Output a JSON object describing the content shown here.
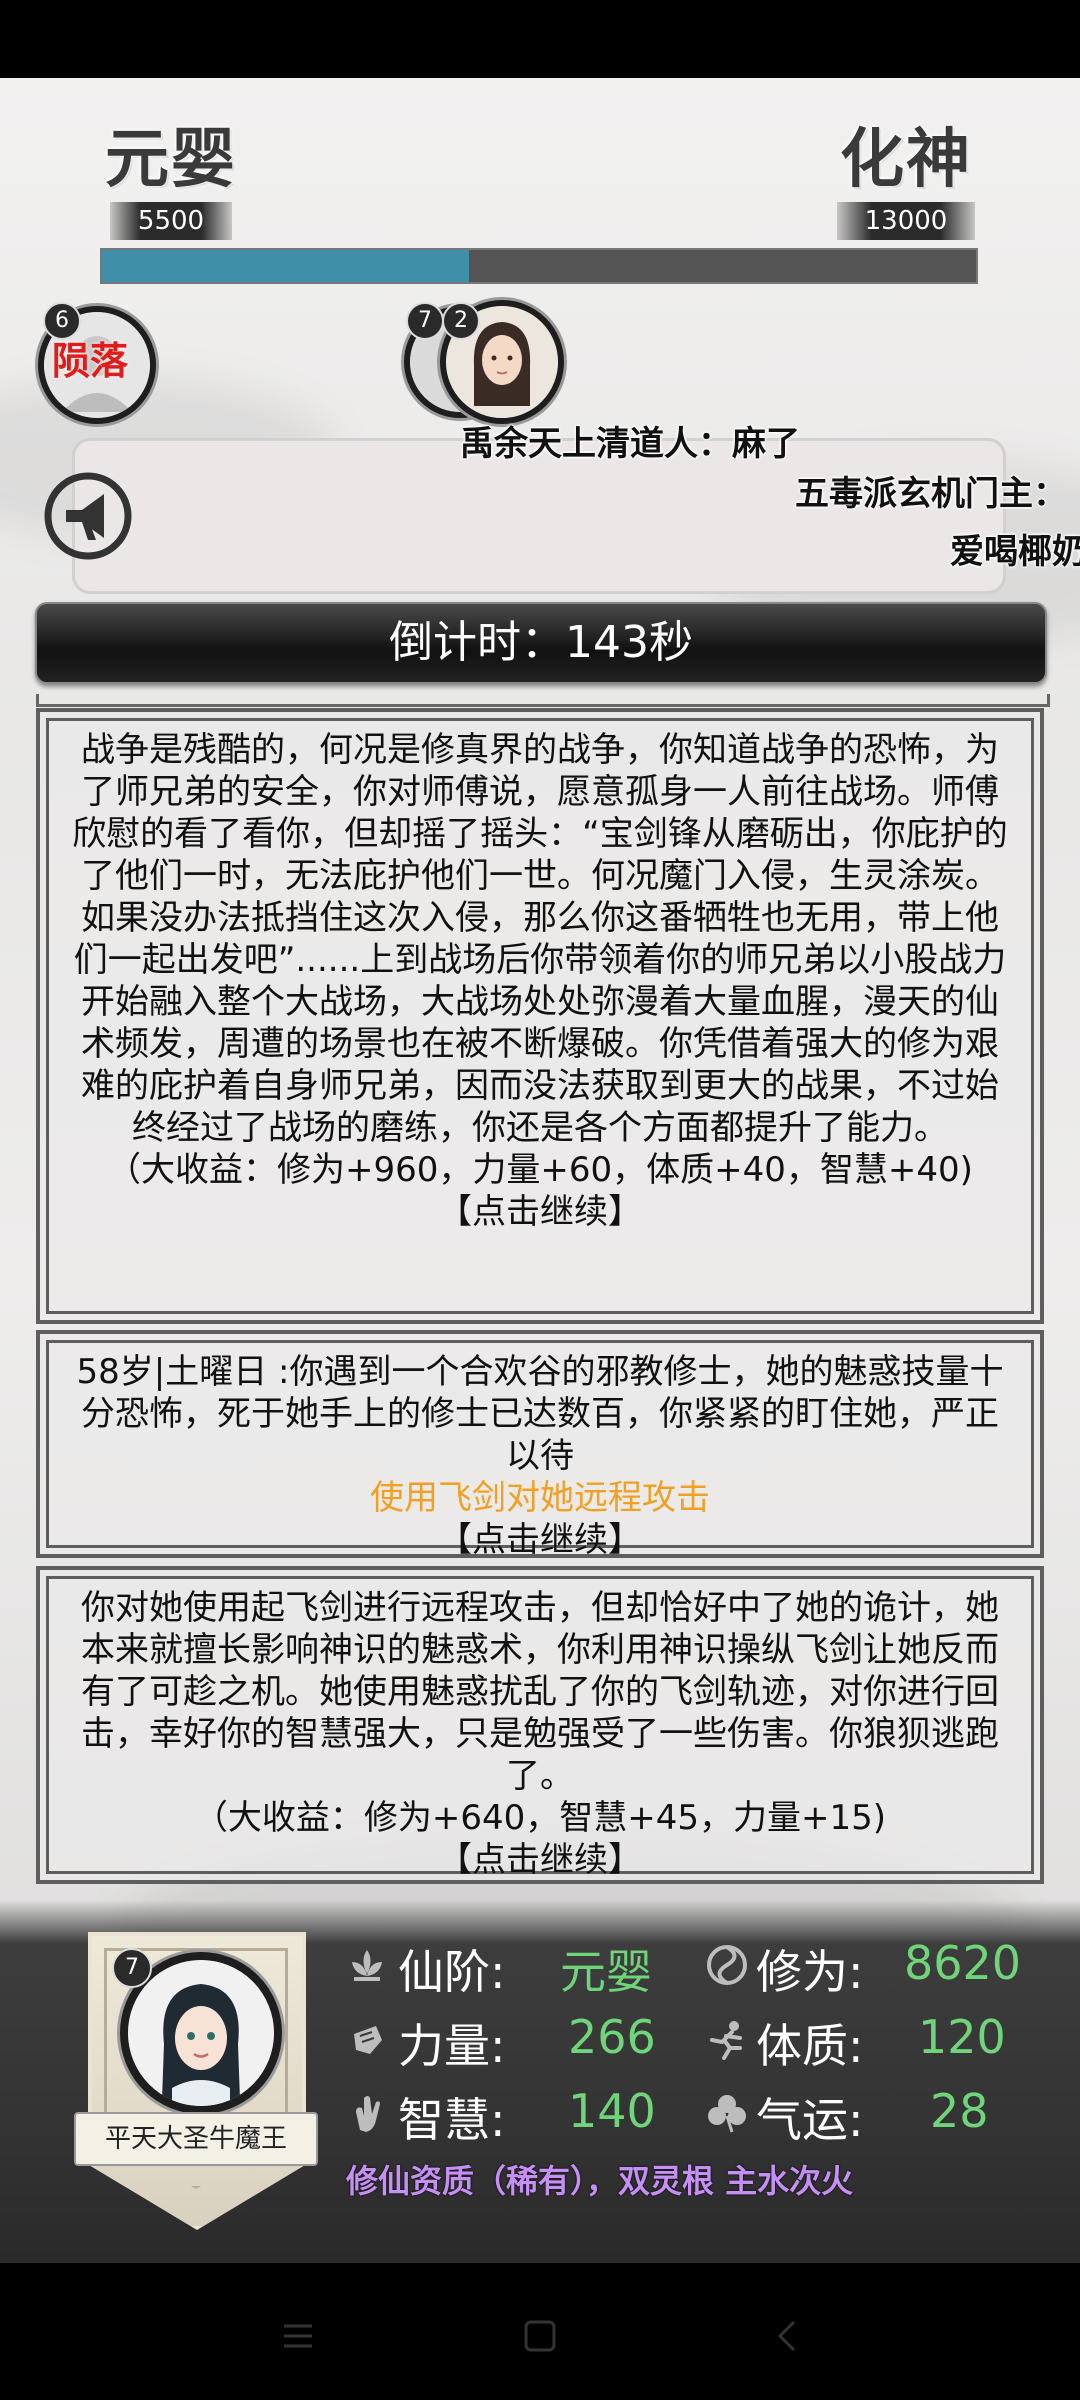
{
  "realm": {
    "current_name": "元婴",
    "current_value": "5500",
    "next_name": "化神",
    "next_value": "13000",
    "progress_percent": 42
  },
  "players": [
    {
      "badge": "6",
      "status": "陨落"
    },
    {
      "badge": "7"
    },
    {
      "badge": "2"
    }
  ],
  "danmu": [
    "禹余天上清道人：麻了",
    "五毒派玄机门主：",
    "爱喝椰奶"
  ],
  "countdown": "倒计时：143秒",
  "events": [
    {
      "text": "战争是残酷的，何况是修真界的战争，你知道战争的恐怖，为了师兄弟的安全，你对师傅说，愿意孤身一人前往战场。师傅欣慰的看了看你，但却摇了摇头：“宝剑锋从磨砺出，你庇护的了他们一时，无法庇护他们一世。何况魔门入侵，生灵涂炭。如果没办法抵挡住这次入侵，那么你这番牺牲也无用，带上他们一起出发吧”......上到战场后你带领着你的师兄弟以小股战力开始融入整个大战场，大战场处处弥漫着大量血腥，漫天的仙术频发，周遭的场景也在被不断爆破。你凭借着强大的修为艰难的庇护着自身师兄弟，因而没法获取到更大的战果，不过始终经过了战场的磨练，你还是各个方面都提升了能力。",
      "reward": "（大收益：修为+960，力量+60，体质+40，智慧+40)",
      "continue": "【点击继续】"
    },
    {
      "text": "58岁|土曜日 :你遇到一个合欢谷的邪教修士，她的魅惑技量十分恐怖，死于她手上的修士已达数百，你紧紧的盯住她，严正以待",
      "choice": "使用飞剑对她远程攻击",
      "continue": "【点击继续】"
    },
    {
      "text": "你对她使用起飞剑进行远程攻击，但却恰好中了她的诡计，她本来就擅长影响神识的魅惑术，你利用神识操纵飞剑让她反而有了可趁之机。她使用魅惑扰乱了你的飞剑轨迹，对你进行回击，幸好你的智慧强大，只是勉强受了一些伤害。你狼狈逃跑了。",
      "reward": "（大收益：修为+640，智慧+45，力量+15)",
      "continue": "【点击继续】"
    }
  ],
  "character": {
    "badge": "7",
    "title": "平天大圣牛魔王",
    "stats": {
      "realm_label": "仙阶:",
      "realm_value": "元婴",
      "cultivation_label": "修为:",
      "cultivation_value": "8620",
      "strength_label": "力量:",
      "strength_value": "266",
      "constitution_label": "体质:",
      "constitution_value": "120",
      "wisdom_label": "智慧:",
      "wisdom_value": "140",
      "luck_label": "气运:",
      "luck_value": "28"
    },
    "aptitude": "修仙资质（稀有），双灵根 主水次火"
  },
  "colors": {
    "progress_fill": "#3f8fa8",
    "stat_value": "#6fd47a",
    "choice_text": "#f0a023",
    "aptitude_text": "#c58ff5",
    "fallen_text": "#e21b1b"
  }
}
